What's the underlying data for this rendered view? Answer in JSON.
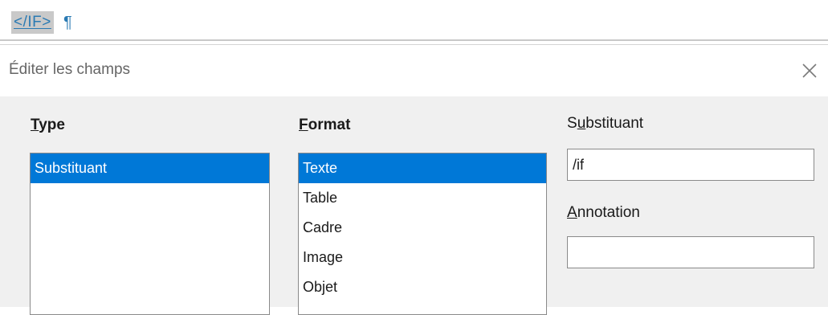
{
  "document": {
    "field_code": "</IF>",
    "pilcrow": "¶"
  },
  "dialog": {
    "title": "Éditer les champs",
    "close_glyph": "×"
  },
  "type_column": {
    "label_mnemonic": "T",
    "label_rest": "ype",
    "items": [
      "Substituant"
    ],
    "selected": "Substituant"
  },
  "format_column": {
    "label_mnemonic": "F",
    "label_rest": "ormat",
    "items": [
      "Texte",
      "Table",
      "Cadre",
      "Image",
      "Objet"
    ],
    "selected": "Texte"
  },
  "substituant": {
    "label_pre": "S",
    "label_mnemonic": "u",
    "label_post": "bstituant",
    "value": "/if"
  },
  "annotation": {
    "label_mnemonic": "A",
    "label_rest": "nnotation",
    "value": ""
  },
  "colors": {
    "selection": "#0078d7",
    "field_code_text": "#2a7ab3",
    "field_code_background": "#c9c9c9",
    "dialog_body": "#f0f0f0"
  },
  "icons": {
    "close": "close-icon",
    "pilcrow": "pilcrow-icon"
  }
}
